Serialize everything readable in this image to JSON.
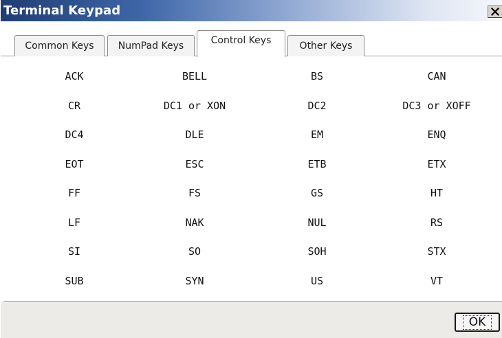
{
  "window": {
    "title": "Terminal Keypad",
    "close_glyph": "✕"
  },
  "tabs": [
    {
      "label": "Common Keys",
      "active": false
    },
    {
      "label": "NumPad Keys",
      "active": false
    },
    {
      "label": "Control Keys",
      "active": true
    },
    {
      "label": "Other Keys",
      "active": false
    }
  ],
  "keys": [
    [
      "ACK",
      "BELL",
      "BS",
      "CAN"
    ],
    [
      "CR",
      "DC1 or XON",
      "DC2",
      "DC3 or XOFF"
    ],
    [
      "DC4",
      "DLE",
      "EM",
      "ENQ"
    ],
    [
      "EOT",
      "ESC",
      "ETB",
      "ETX"
    ],
    [
      "FF",
      "FS",
      "GS",
      "HT"
    ],
    [
      "LF",
      "NAK",
      "NUL",
      "RS"
    ],
    [
      "SI",
      "SO",
      "SOH",
      "STX"
    ],
    [
      "SUB",
      "SYN",
      "US",
      "VT"
    ]
  ],
  "footer": {
    "ok_label": "OK"
  }
}
